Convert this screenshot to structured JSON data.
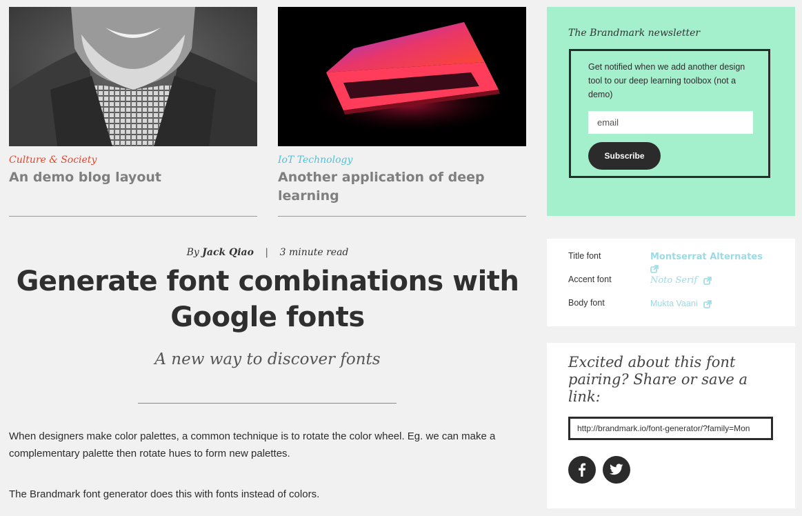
{
  "cards": [
    {
      "category": "Culture & Society",
      "category_color": "#e2472f",
      "title": "An demo blog layout"
    },
    {
      "category": "IoT Technology",
      "category_color": "#4fc2d8",
      "title": "Another application of deep learning"
    }
  ],
  "article": {
    "by_prefix": "By",
    "author": "Jack Qiao",
    "separator": "|",
    "read_time": "3 minute read",
    "title": "Generate font combinations with Google fonts",
    "subtitle": "A new way to discover fonts",
    "paragraphs": [
      "When designers make color palettes, a common technique is to rotate the color wheel. Eg. we can make a complementary palette then rotate hues to form new palettes.",
      "The Brandmark font generator does this with fonts instead of colors."
    ]
  },
  "newsletter": {
    "title": "The Brandmark newsletter",
    "text": "Get notified when we add another design tool to our deep learning toolbox (not a demo)",
    "email_placeholder": "email",
    "subscribe_label": "Subscribe",
    "bg_color": "#a4f0cc"
  },
  "fonts": {
    "title_label": "Title font",
    "title_value": "Montserrat Alternates",
    "accent_label": "Accent font",
    "accent_value": "Noto Serif",
    "body_label": "Body font",
    "body_value": "Mukta Vaani",
    "link_color": "#9adbe6"
  },
  "share": {
    "title": "Excited about this font pairing? Share or save a link:",
    "url": "http://brandmark.io/font-generator/?family=Mon",
    "icons": [
      "facebook-icon",
      "twitter-icon"
    ]
  }
}
